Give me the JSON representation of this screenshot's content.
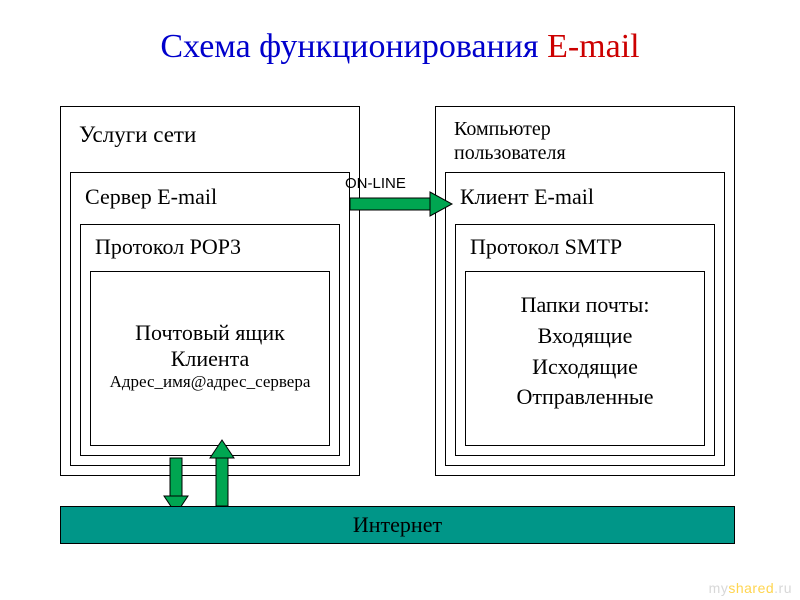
{
  "title": {
    "part1": "Схема функционирования ",
    "part2": "E-mail"
  },
  "left": {
    "outer": "Услуги сети",
    "server": "Сервер E-mail",
    "protocol": "Протокол POP3",
    "mailbox": {
      "line1": "Почтовый ящик",
      "line2": "Клиента",
      "address": "Адрес_имя@адрес_сервера"
    }
  },
  "right": {
    "outer_line1": "Компьютер",
    "outer_line2": "пользователя",
    "client": "Клиент E-mail",
    "protocol": "Протокол SMTP",
    "folders": {
      "heading": "Папки почты:",
      "item1": "Входящие",
      "item2": "Исходящие",
      "item3": "Отправленные"
    }
  },
  "connection_label": "ON-LINE",
  "internet": "Интернет",
  "watermark": {
    "t1": "my",
    "t2": "shared",
    "t3": ".ru"
  },
  "colors": {
    "title_part1": "#0000cc",
    "title_part2": "#cc0000",
    "internet_bg": "#009688",
    "arrow_green": "#00a651"
  }
}
